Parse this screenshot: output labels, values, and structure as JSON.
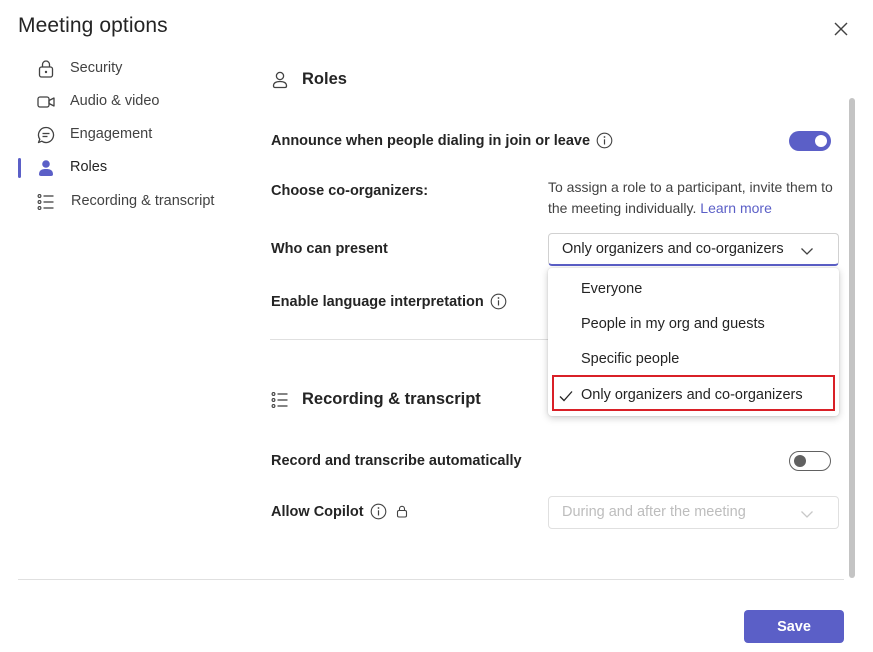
{
  "dialog": {
    "title": "Meeting options",
    "close_icon": "close-icon"
  },
  "sidebar": {
    "items": [
      {
        "label": "Security",
        "icon": "lock-icon",
        "active": false
      },
      {
        "label": "Audio & video",
        "icon": "video-icon",
        "active": false
      },
      {
        "label": "Engagement",
        "icon": "chat-icon",
        "active": false
      },
      {
        "label": "Roles",
        "icon": "person-icon",
        "active": true
      },
      {
        "label": "Recording & transcript",
        "icon": "list-icon",
        "active": false
      }
    ]
  },
  "roles": {
    "heading": "Roles",
    "announce": {
      "label": "Announce when people dialing in join or leave",
      "on": true
    },
    "co_organizers": {
      "label": "Choose co-organizers:",
      "helper": "To assign a role to a participant, invite them to the meeting individually.",
      "link": "Learn more"
    },
    "who_can_present": {
      "label": "Who can present",
      "value": "Only organizers and co-organizers",
      "options": [
        "Everyone",
        "People in my org and guests",
        "Specific people",
        "Only organizers and co-organizers"
      ],
      "selected_index": 3
    },
    "language_interpretation": {
      "label": "Enable language interpretation"
    }
  },
  "recording": {
    "heading": "Recording & transcript",
    "record_auto": {
      "label": "Record and transcribe automatically",
      "on": false
    },
    "allow_copilot": {
      "label": "Allow Copilot",
      "value": "During and after the meeting",
      "disabled": true
    }
  },
  "footer": {
    "save_label": "Save"
  },
  "colors": {
    "accent": "#5b5fc7",
    "highlight": "#d92027"
  }
}
